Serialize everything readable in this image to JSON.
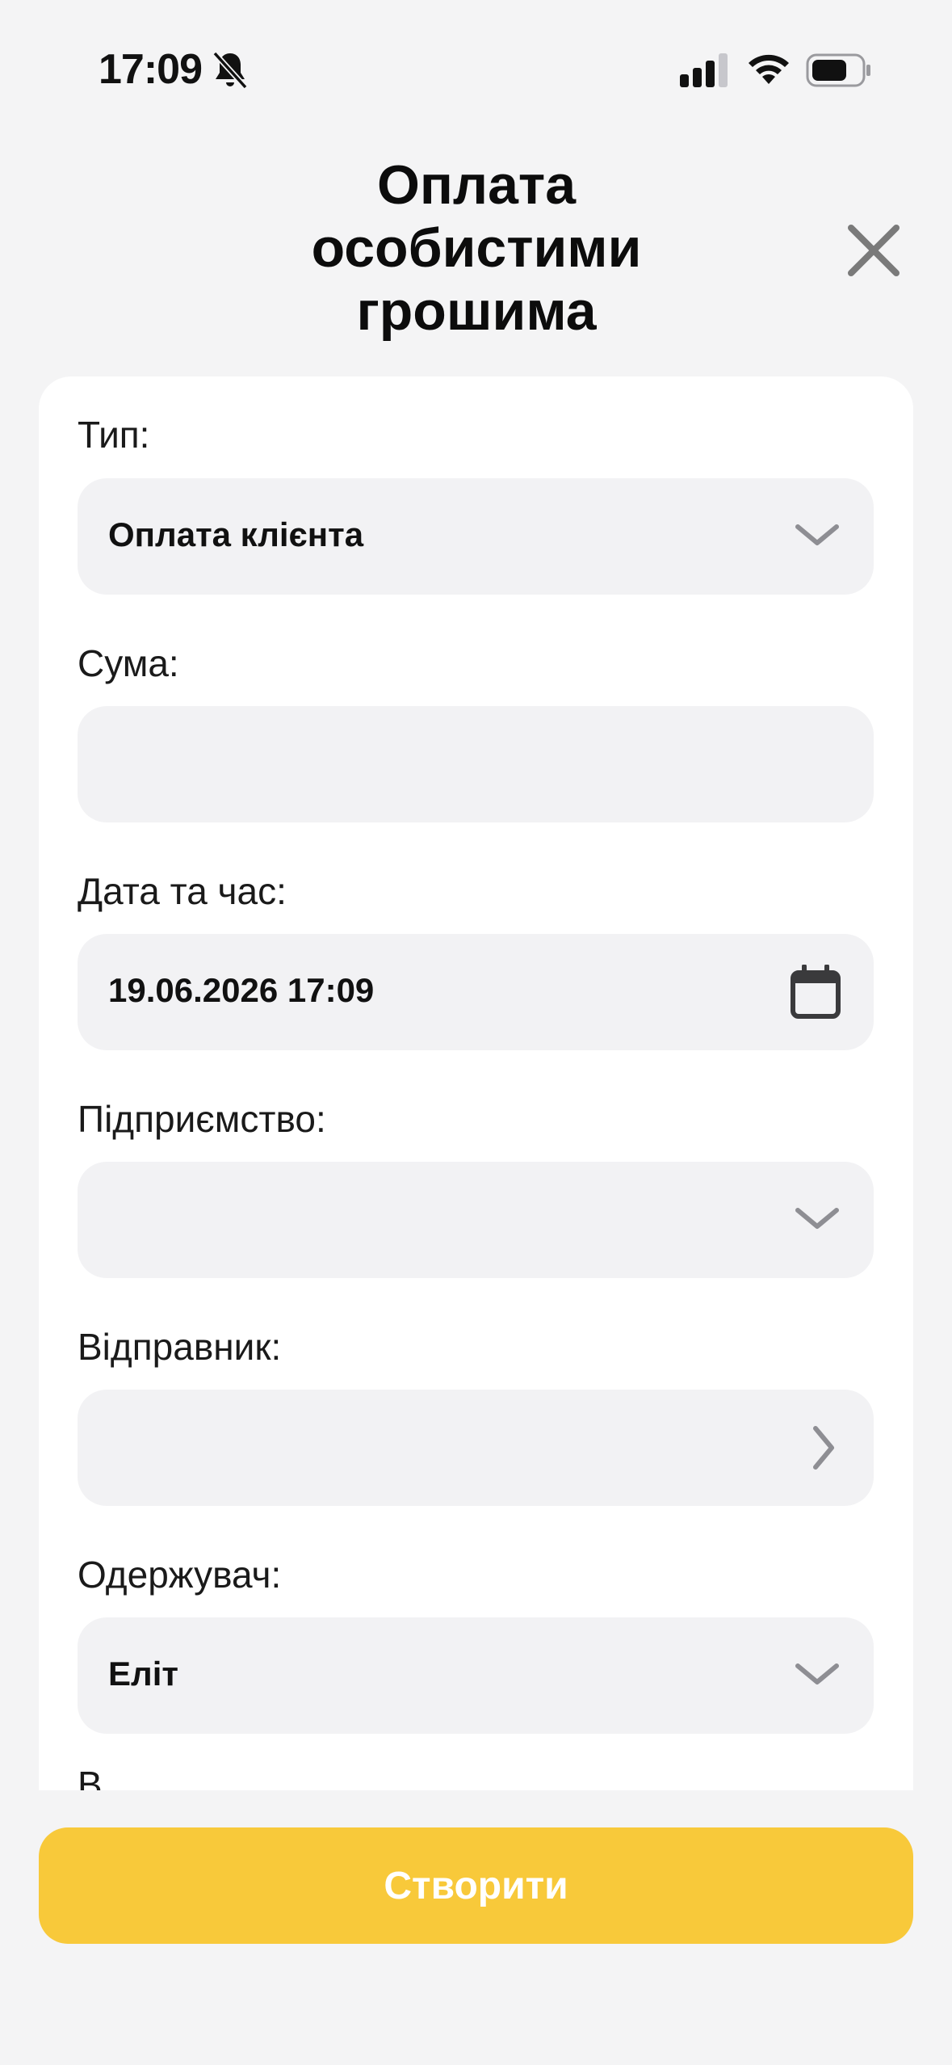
{
  "status_bar": {
    "time": "17:09",
    "icons": [
      "bell-slash-icon",
      "cellular-signal-icon",
      "wifi-icon",
      "battery-icon"
    ]
  },
  "header": {
    "title": "Оплата особистими грошима",
    "close_icon": "close-icon"
  },
  "form": {
    "type": {
      "label": "Тип:",
      "value": "Оплата клієнта",
      "icon": "chevron-down-icon"
    },
    "amount": {
      "label": "Сума:",
      "value": ""
    },
    "datetime": {
      "label": "Дата та час:",
      "value": "19.06.2026 17:09",
      "icon": "calendar-icon"
    },
    "company": {
      "label": "Підприємство:",
      "value": "",
      "icon": "chevron-down-icon"
    },
    "sender": {
      "label": "Відправник:",
      "value": "",
      "icon": "chevron-right-icon"
    },
    "recipient": {
      "label": "Одержувач:",
      "value": "Еліт",
      "icon": "chevron-down-icon"
    },
    "next_label_partial": "В"
  },
  "footer": {
    "create_label": "Створити"
  },
  "colors": {
    "background": "#F4F4F5",
    "card": "#FFFFFF",
    "field": "#F2F2F4",
    "accent": "#F8C93A",
    "icon_gray": "#8E8E93"
  }
}
